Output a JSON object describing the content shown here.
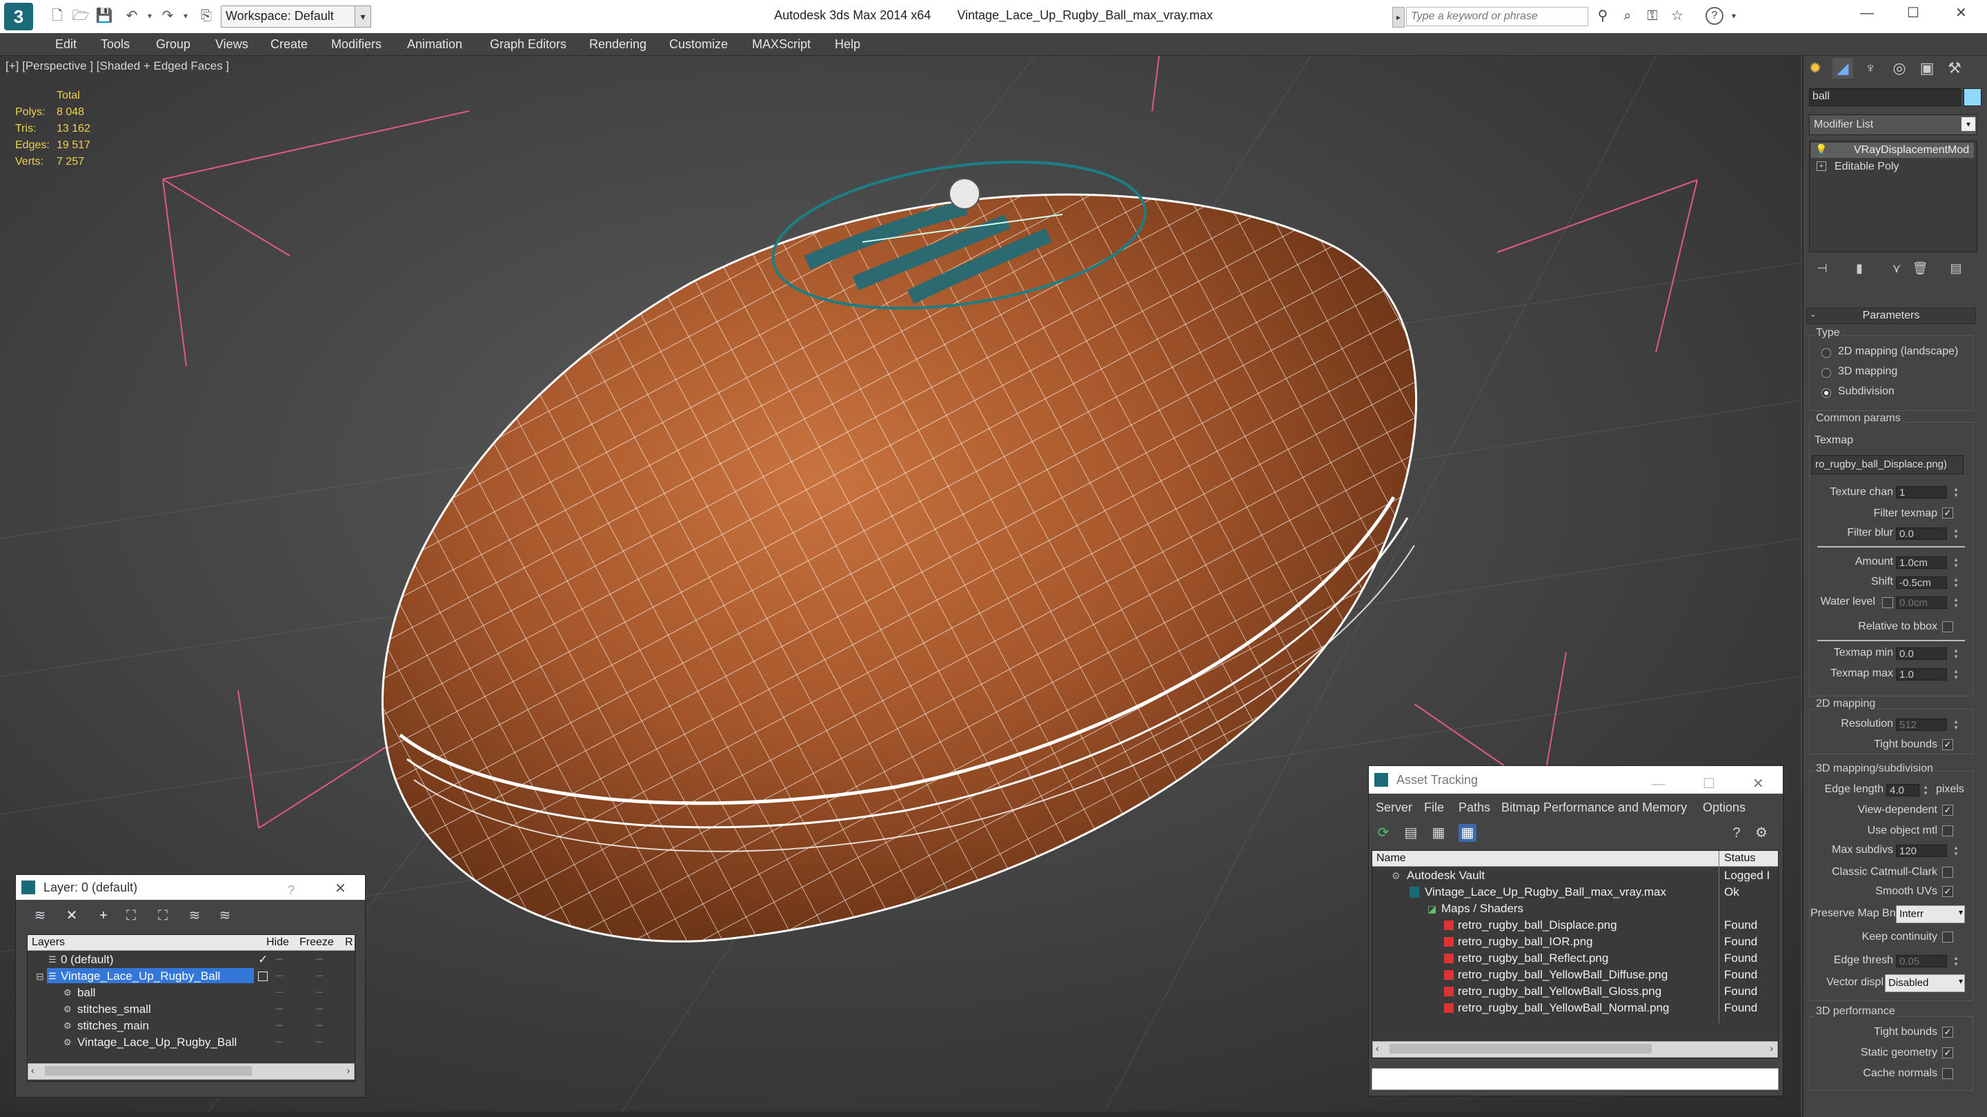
{
  "window": {
    "app_title": "Autodesk 3ds Max  2014 x64",
    "file_title": "Vintage_Lace_Up_Rugby_Ball_max_vray.max",
    "workspace_label": "Workspace: Default",
    "search_placeholder": "Type a keyword or phrase"
  },
  "menu": [
    "Edit",
    "Tools",
    "Group",
    "Views",
    "Create",
    "Modifiers",
    "Animation",
    "Graph Editors",
    "Rendering",
    "Customize",
    "MAXScript",
    "Help"
  ],
  "viewport": {
    "label": "[+] [Perspective ] [Shaded + Edged Faces ]",
    "stats_header": "Total",
    "stats": [
      {
        "label": "Polys:",
        "value": "8 048"
      },
      {
        "label": "Tris:",
        "value": "13 162"
      },
      {
        "label": "Edges:",
        "value": "19 517"
      },
      {
        "label": "Verts:",
        "value": "7 257"
      }
    ]
  },
  "command_panel": {
    "object_name": "ball",
    "modifier_list_label": "Modifier List",
    "stack": [
      "VRayDisplacementMod",
      "Editable Poly"
    ],
    "parameters_title": "Parameters",
    "type_group": "Type",
    "type_options": [
      "2D mapping (landscape)",
      "3D mapping",
      "Subdivision"
    ],
    "type_selected_index": 2,
    "common_group": "Common params",
    "texmap_label": "Texmap",
    "texmap_value": "ro_rugby_ball_Displace.png)",
    "texture_chan_label": "Texture chan",
    "texture_chan_value": "1",
    "filter_texmap_label": "Filter texmap",
    "filter_blur_label": "Filter blur",
    "filter_blur_value": "0.0",
    "amount_label": "Amount",
    "amount_value": "1.0cm",
    "shift_label": "Shift",
    "shift_value": "-0.5cm",
    "water_level_label": "Water level",
    "water_level_value": "0.0cm",
    "relative_bbox_label": "Relative to bbox",
    "texmap_min_label": "Texmap min",
    "texmap_min_value": "0.0",
    "texmap_max_label": "Texmap max",
    "texmap_max_value": "1.0",
    "mapping2d_group": "2D mapping",
    "resolution_label": "Resolution",
    "resolution_value": "512",
    "tight_bounds_label": "Tight bounds",
    "mapping3d_group": "3D mapping/subdivision",
    "edge_length_label": "Edge length",
    "edge_length_value": "4.0",
    "pixels_label": "pixels",
    "view_dependent_label": "View-dependent",
    "use_object_mtl_label": "Use object mtl",
    "max_subdivs_label": "Max subdivs",
    "max_subdivs_value": "120",
    "catmull_label": "Classic Catmull-Clark",
    "smooth_uvs_label": "Smooth UVs",
    "preserve_label": "Preserve Map Bnd",
    "preserve_value": "Interr",
    "keep_continuity_label": "Keep continuity",
    "edge_thresh_label": "Edge thresh",
    "edge_thresh_value": "0.05",
    "vector_displ_label": "Vector displ",
    "vector_displ_value": "Disabled",
    "performance_group": "3D performance",
    "perf_tight_bounds_label": "Tight bounds",
    "static_geometry_label": "Static geometry",
    "cache_normals_label": "Cache normals"
  },
  "layer_window": {
    "title": "Layer: 0 (default)",
    "columns": [
      "Layers",
      "Hide",
      "Freeze",
      "R"
    ],
    "rows": [
      {
        "name": "0 (default)",
        "indent": 1
      },
      {
        "name": "Vintage_Lace_Up_Rugby_Ball",
        "indent": 1
      },
      {
        "name": "ball",
        "indent": 2
      },
      {
        "name": "stitches_small",
        "indent": 2
      },
      {
        "name": "stitches_main",
        "indent": 2
      },
      {
        "name": "Vintage_Lace_Up_Rugby_Ball",
        "indent": 2
      }
    ]
  },
  "asset_window": {
    "title": "Asset Tracking",
    "menu": [
      "Server",
      "File",
      "Paths",
      "Bitmap Performance and Memory",
      "Options"
    ],
    "columns": [
      "Name",
      "Status"
    ],
    "rows": [
      {
        "name": "Autodesk Vault",
        "status": "Logged I"
      },
      {
        "name": "Vintage_Lace_Up_Rugby_Ball_max_vray.max",
        "status": "Ok"
      },
      {
        "name": "Maps / Shaders",
        "status": ""
      },
      {
        "name": "retro_rugby_ball_Displace.png",
        "status": "Found"
      },
      {
        "name": "retro_rugby_ball_IOR.png",
        "status": "Found"
      },
      {
        "name": "retro_rugby_ball_Reflect.png",
        "status": "Found"
      },
      {
        "name": "retro_rugby_ball_YellowBall_Diffuse.png",
        "status": "Found"
      },
      {
        "name": "retro_rugby_ball_YellowBall_Gloss.png",
        "status": "Found"
      },
      {
        "name": "retro_rugby_ball_YellowBall_Normal.png",
        "status": "Found"
      }
    ]
  },
  "colors": {
    "viewport_bg": "#424242",
    "stats_text": "#f0d24a",
    "ball_leather": "#a4552a",
    "wireframe": "#ffffff",
    "laces_selected": "#1c7f86",
    "bbox_lines": "#e05a86",
    "layer_selected": "#3378d8"
  }
}
